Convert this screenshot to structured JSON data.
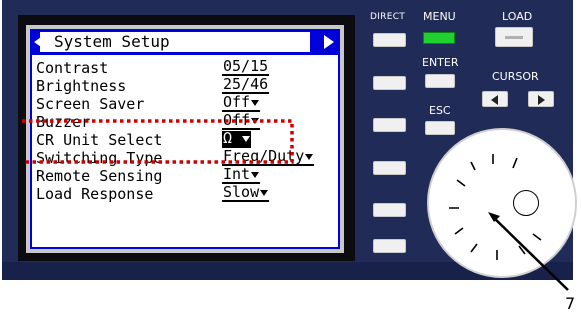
{
  "screen": {
    "title": "System Setup",
    "items": [
      {
        "label": "Contrast",
        "value": "05/15"
      },
      {
        "label": "Brightness",
        "value": "25/46"
      },
      {
        "label": "Screen Saver",
        "value": "Off"
      },
      {
        "label": "Buzzer",
        "value": "Off"
      },
      {
        "label": "CR Unit Select",
        "value": "Ω"
      },
      {
        "label": "Switching Type",
        "value": "Freq/Duty"
      },
      {
        "label": "Remote Sensing",
        "value": "Int"
      },
      {
        "label": "Load Response",
        "value": "Slow"
      }
    ]
  },
  "panel": {
    "direct_label": "DIRECT",
    "menu_label": "MENU",
    "load_label": "LOAD",
    "enter_label": "ENTER",
    "cursor_label": "CURSOR",
    "esc_label": "ESC"
  },
  "callout": "7",
  "colors": {
    "panel_bg": "#202b58",
    "lcd_border": "#0000d8",
    "highlight_dots": "#d00000",
    "menu_led": "#20d030"
  }
}
